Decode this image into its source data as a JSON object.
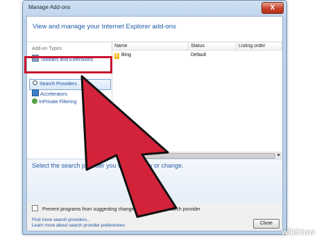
{
  "window": {
    "title": "Manage Add-ons",
    "close_glyph": "X"
  },
  "header": {
    "text": "View and manage your Internet Explorer add-ons"
  },
  "sidebar": {
    "heading": "Add-on Types",
    "items": [
      {
        "label": "Toolbars and Extensions",
        "icon": "toolbar-icon"
      },
      {
        "label": "Search Providers",
        "icon": "search-icon",
        "selected": true
      },
      {
        "label": "Accelerators",
        "icon": "accelerator-icon"
      },
      {
        "label": "InPrivate Filtering",
        "icon": "inprivate-icon"
      }
    ]
  },
  "table": {
    "columns": [
      "Name",
      "Status",
      "Listing order"
    ],
    "rows": [
      {
        "name": "Bing",
        "status": "Default",
        "listing_order": ""
      }
    ]
  },
  "detail": {
    "text": "Select the search provider you want to view or change."
  },
  "options": {
    "prevent_label": "Prevent programs from suggesting changes to my default search provider",
    "prevent_checked": false
  },
  "links": {
    "find_more": "Find more search providers...",
    "learn_more": "Learn more about search provider preferences"
  },
  "buttons": {
    "close": "Close"
  },
  "overlay": {
    "arrow_color": "#d3233a",
    "highlight_color": "#c8102e"
  },
  "watermark": {
    "text": "wikiHow"
  }
}
